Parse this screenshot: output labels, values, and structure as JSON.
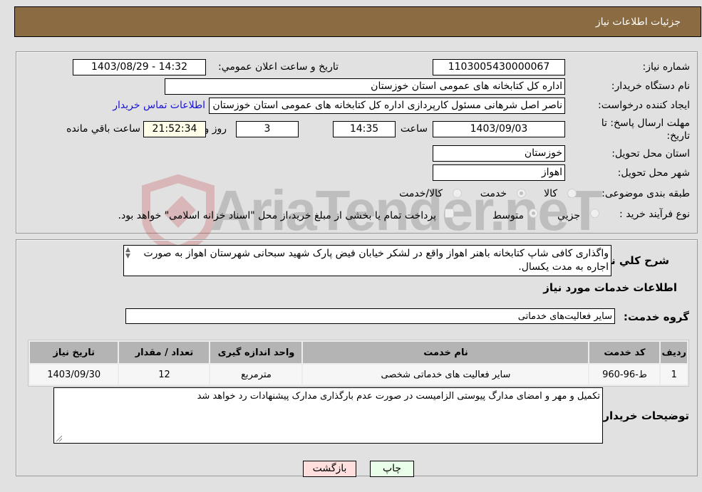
{
  "header": {
    "title": "جزئیات اطلاعات نیاز"
  },
  "form": {
    "need_number": {
      "label": "شماره نیاز:",
      "value": "1103005430000067"
    },
    "announce_datetime": {
      "label": "تاریخ و ساعت اعلان عمومي:",
      "value": "1403/08/29 - 14:32"
    },
    "buyer_org": {
      "label": "نام دستگاه خریدار:",
      "value": "اداره کل کتابخانه های عمومی استان خوزستان"
    },
    "requester": {
      "label": "ایجاد کننده درخواست:",
      "value": "ناصر اصل شرهانی مسئول کارپردازی اداره کل کتابخانه های عمومی استان خوزستان",
      "contact_link": "اطلاعات تماس خریدار"
    },
    "deadline": {
      "label": "مهلت ارسال پاسخ: تا تاریخ:",
      "date": "1403/09/03",
      "time_label": "ساعت",
      "time": "14:35",
      "days": "3",
      "days_label": "روز و",
      "remaining": "21:52:34",
      "remaining_label": "ساعت باقي مانده"
    },
    "province": {
      "label": "استان محل تحویل:",
      "value": "خوزستان"
    },
    "city": {
      "label": "شهر محل تحویل:",
      "value": "اهواز"
    },
    "category": {
      "label": "طبقه بندی موضوعی:",
      "options": [
        "کالا",
        "خدمت",
        "کالا/خدمت"
      ],
      "selected": "خدمت"
    },
    "purchase_type": {
      "label": "نوع فرآیند خرید :",
      "options": [
        "جزيي",
        "متوسط"
      ],
      "selected": "متوسط",
      "treasury_note": "پرداخت تمام یا بخشی از مبلغ خرید،از محل \"اسناد خزانه اسلامی\" خواهد بود."
    }
  },
  "description": {
    "label": "شرح کلي نياز:",
    "text": "واگذاری کافی شاپ کتابخانه باهنر اهواز واقع در لشکر  خیابان فیض پارک شهید سبحانی شهرستان اهواز به صورت اجاره به مدت یکسال."
  },
  "services": {
    "section_title": "اطلاعات خدمات مورد نیاز",
    "group_label": "گروه خدمت:",
    "group_value": "سایر فعالیت‌های خدماتی",
    "table": {
      "headers": [
        "ردیف",
        "کد خدمت",
        "نام خدمت",
        "واحد اندازه گیری",
        "تعداد / مقدار",
        "تاریخ نیاز"
      ],
      "rows": [
        [
          "1",
          "ط-96-960",
          "سایر فعالیت های خدماتی شخصی",
          "مترمربع",
          "12",
          "1403/09/30"
        ]
      ]
    }
  },
  "buyer_notes": {
    "label": "توضیحات خریدار:",
    "text": "تکمیل و مهر و امضای مدارگ پیوستی الزامیست در صورت عدم بارگذاری مدارک پیشنهادات رد خواهد شد"
  },
  "buttons": {
    "print": "چاپ",
    "back": "بازگشت"
  },
  "watermark": {
    "text": "AriaTender.neT"
  },
  "colors": {
    "header_bg": "#8b6c42",
    "link": "#1a12d6",
    "print_bg": "#eaffea",
    "back_bg": "#ffdede",
    "remaining_bg": "#fffee8"
  }
}
